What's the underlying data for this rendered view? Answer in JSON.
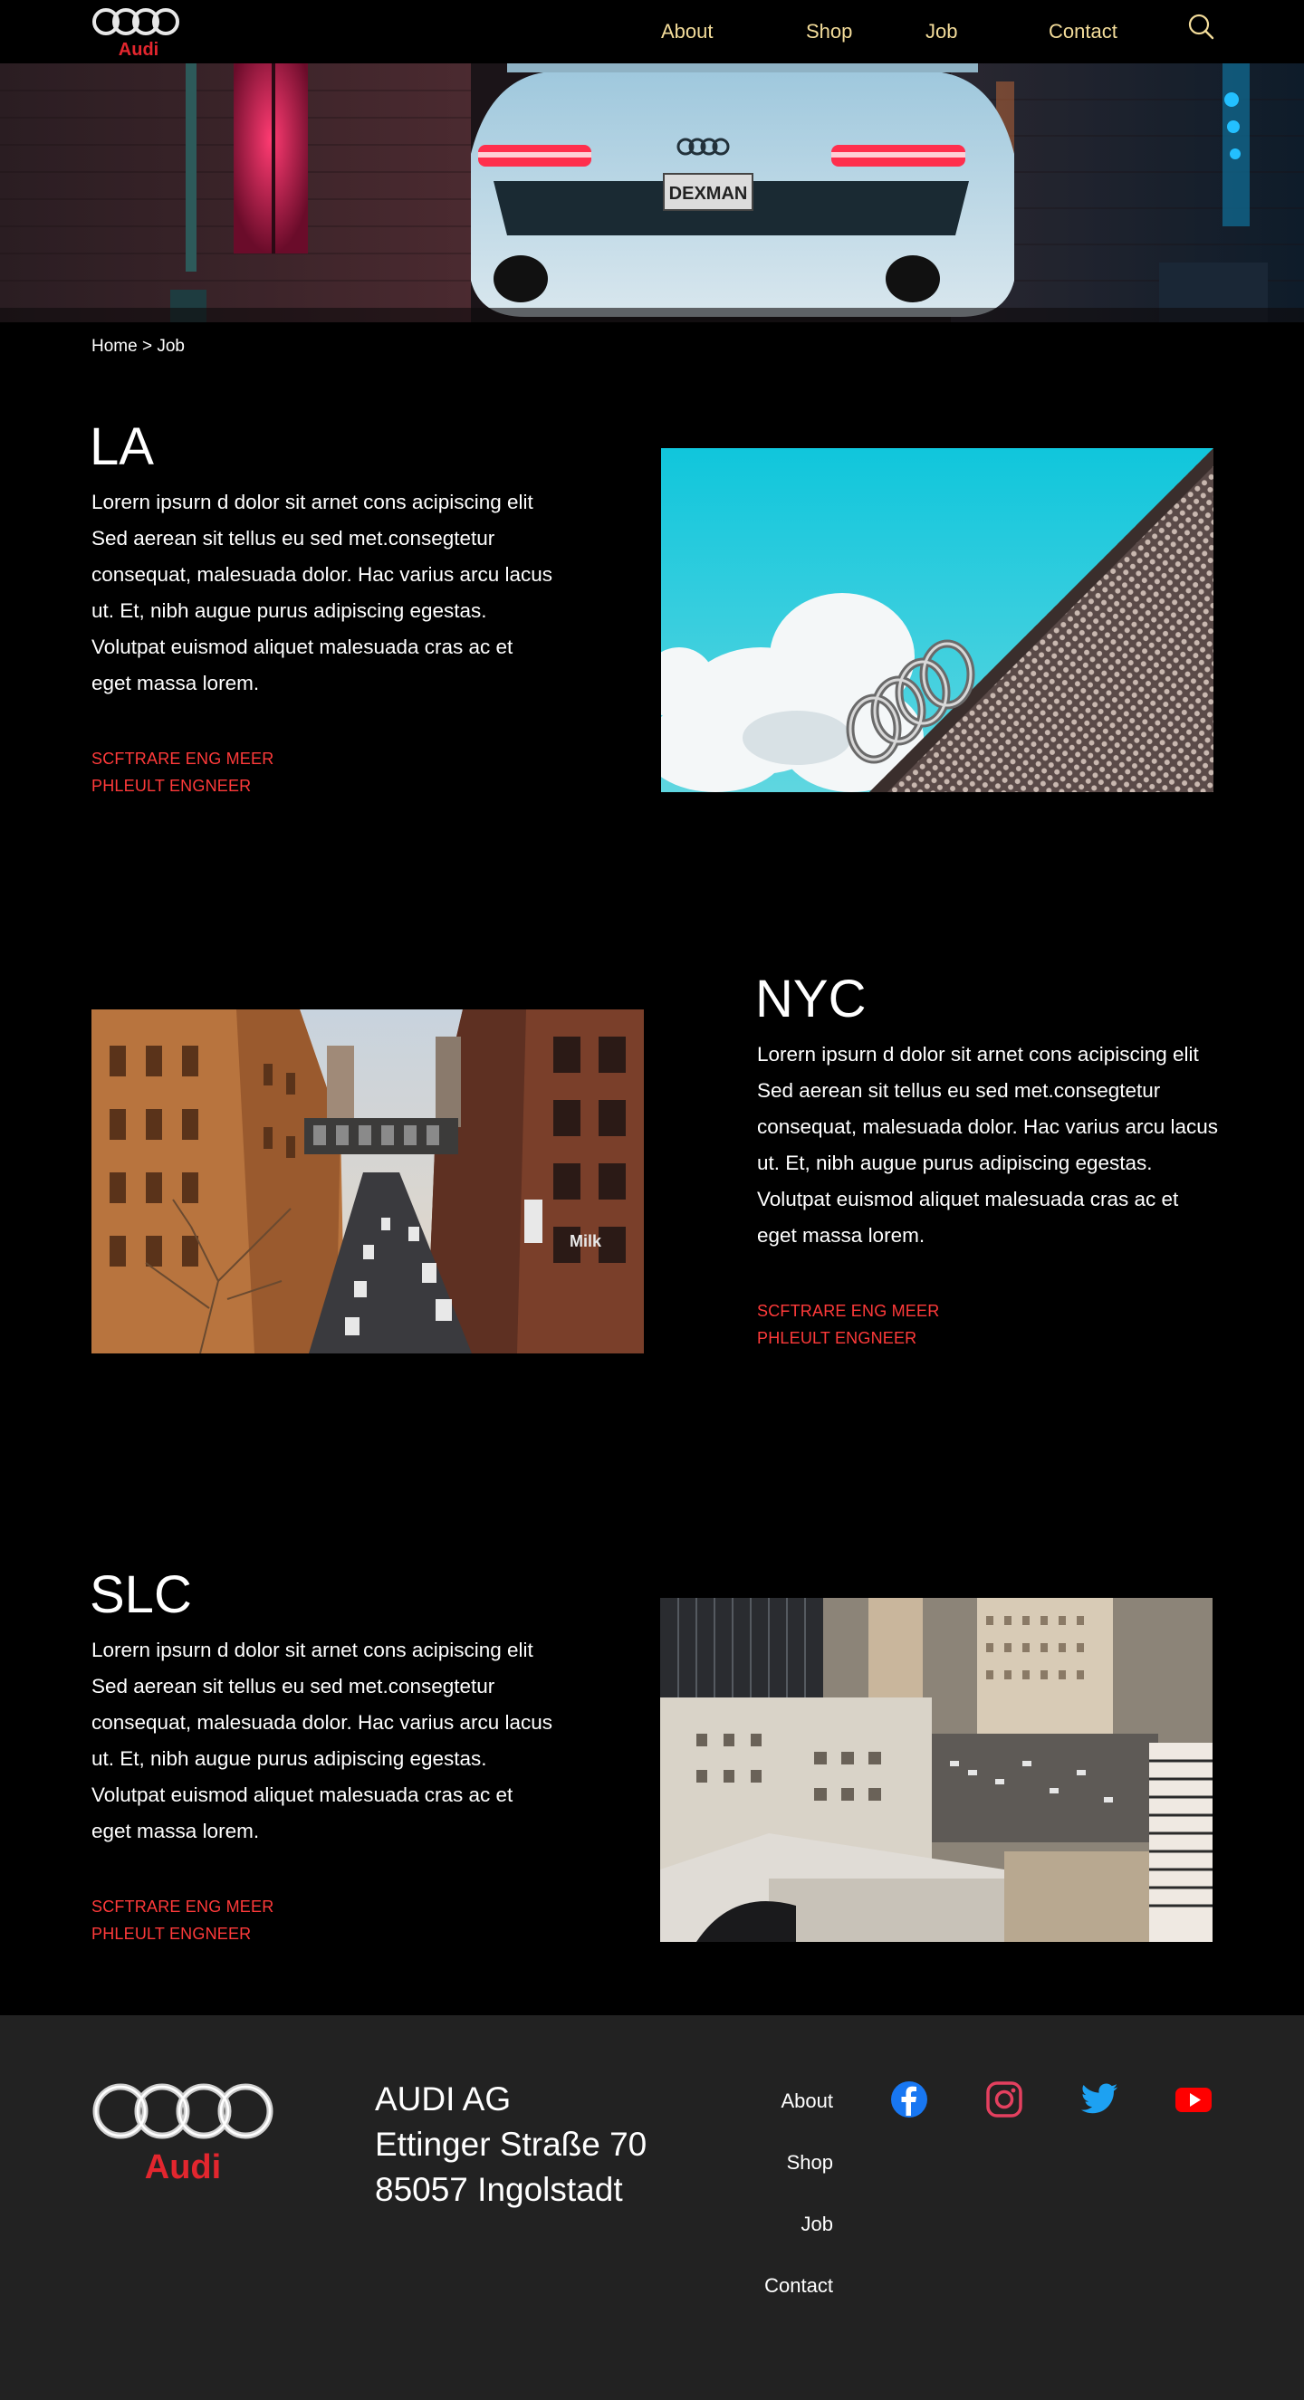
{
  "nav": {
    "logo_text": "Audi",
    "links": [
      "About",
      "Shop",
      "Job",
      "Contact"
    ],
    "search_icon": "search-icon"
  },
  "hero": {
    "plate_text": "DEXMAN"
  },
  "breadcrumb": "Home > Job",
  "jobs": [
    {
      "city": "LA",
      "desc": "Lorern ipsurn d dolor sit arnet cons acipiscing elit Sed aerean sit tellus eu sed met.consegtetur consequat, malesuada dolor. Hac varius arcu lacus ut. Et, nibh augue purus adipiscing egestas. Volutpat euismod aliquet malesuada cras ac et eget massa lorem.",
      "roles": [
        "SCFTRARE ENG MEER",
        "PHLEULT ENGNEER"
      ]
    },
    {
      "city": "NYC",
      "desc": "Lorern ipsurn d dolor sit arnet cons acipiscing elit Sed aerean sit tellus eu sed met.consegtetur consequat, malesuada dolor. Hac varius arcu lacus ut. Et, nibh augue purus adipiscing egestas. Volutpat euismod aliquet malesuada cras ac et eget massa lorem.",
      "roles": [
        "SCFTRARE ENG MEER",
        "PHLEULT ENGNEER"
      ],
      "sign_text": "Milk"
    },
    {
      "city": "SLC",
      "desc": "Lorern ipsurn d dolor sit arnet cons acipiscing elit Sed aerean sit tellus eu sed met.consegtetur consequat, malesuada dolor. Hac varius arcu lacus ut. Et, nibh augue purus adipiscing egestas. Volutpat euismod aliquet malesuada cras ac et eget massa lorem.",
      "roles": [
        "SCFTRARE ENG MEER",
        "PHLEULT ENGNEER"
      ]
    }
  ],
  "footer": {
    "logo_text": "Audi",
    "address": [
      "AUDI AG",
      "Ettinger Straße 70",
      "85057 Ingolstadt"
    ],
    "links": [
      "About",
      "Shop",
      "Job",
      "Contact"
    ],
    "social": [
      "facebook-icon",
      "instagram-icon",
      "twitter-icon",
      "youtube-icon"
    ]
  },
  "colors": {
    "background": "#000000",
    "nav_link": "#f3dc9a",
    "accent_red": "#ff3a3a",
    "footer_bg": "#222222",
    "logo_red": "#e3262e"
  }
}
